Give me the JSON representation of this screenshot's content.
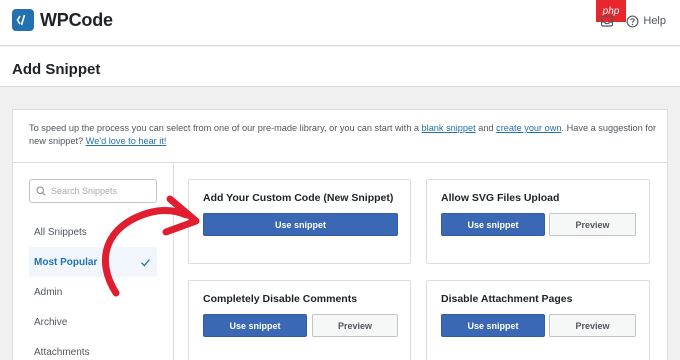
{
  "app": {
    "logo_text": "WPCode",
    "help_label": "Help",
    "badge_text": "php"
  },
  "page": {
    "title": "Add Snippet"
  },
  "intro": {
    "text_before": "To speed up the process you can select from one of our pre-made library, or you can start with a ",
    "link_blank": "blank snippet",
    "text_and": " and ",
    "link_create": "create your own",
    "text_after": ". Have a suggestion for new snippet? ",
    "link_feedback": "We'd love to hear it!"
  },
  "search": {
    "placeholder": "Search Snippets"
  },
  "categories": [
    {
      "label": "All Snippets"
    },
    {
      "label": "Most Popular",
      "active": true
    },
    {
      "label": "Admin"
    },
    {
      "label": "Archive"
    },
    {
      "label": "Attachments"
    }
  ],
  "snippets": [
    {
      "title": "Add Your Custom Code (New Snippet)",
      "use_label": "Use snippet"
    },
    {
      "title": "Allow SVG Files Upload",
      "use_label": "Use snippet",
      "preview_label": "Preview"
    },
    {
      "title": "Completely Disable Comments",
      "use_label": "Use snippet",
      "preview_label": "Preview"
    },
    {
      "title": "Disable Attachment Pages",
      "use_label": "Use snippet",
      "preview_label": "Preview"
    }
  ],
  "colors": {
    "accent": "#2271b1",
    "button": "#3a68b4",
    "annotation_arrow": "#e01e2f",
    "badge": "#e8262b"
  }
}
